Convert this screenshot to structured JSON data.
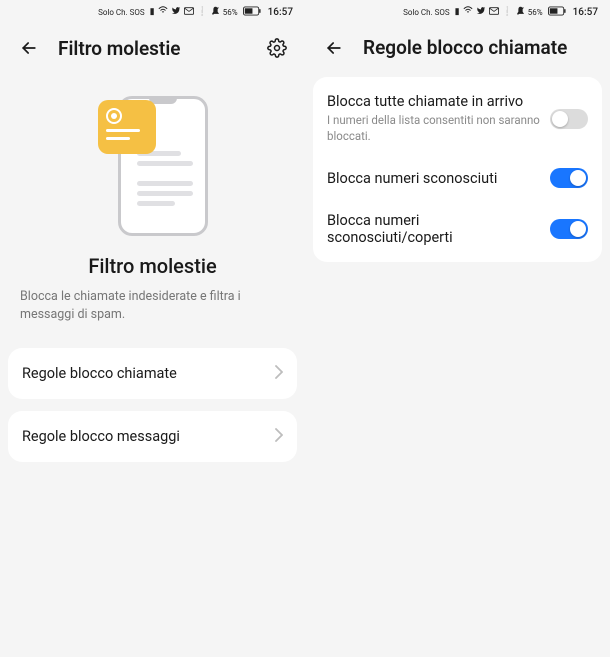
{
  "status": {
    "carrier": "Solo Ch. SOS",
    "battery": "56%",
    "time": "16:57"
  },
  "left": {
    "title": "Filtro molestie",
    "illus_title": "Filtro molestie",
    "illus_sub": "Blocca le chiamate indesiderate e filtra i messaggi di spam.",
    "items": [
      {
        "label": "Regole blocco chiamate"
      },
      {
        "label": "Regole blocco messaggi"
      }
    ]
  },
  "right": {
    "title": "Regole blocco chiamate",
    "settings": [
      {
        "title": "Blocca tutte chiamate in arrivo",
        "sub": "I numeri della lista consentiti non saranno bloccati.",
        "on": false
      },
      {
        "title": "Blocca numeri sconosciuti",
        "sub": "",
        "on": true
      },
      {
        "title": "Blocca numeri sconosciuti/coperti",
        "sub": "",
        "on": true
      }
    ]
  }
}
